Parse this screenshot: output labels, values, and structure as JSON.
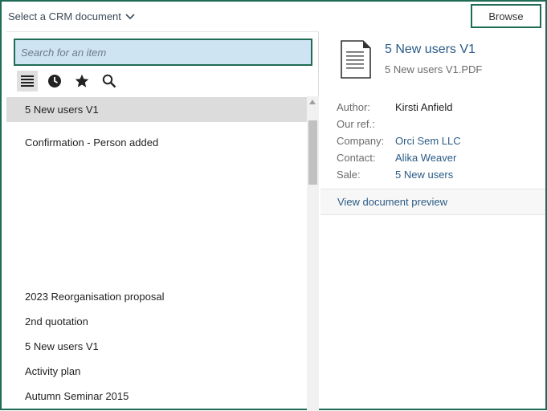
{
  "header": {
    "select_label": "Select a CRM document",
    "browse_label": "Browse"
  },
  "search": {
    "placeholder": "Search for an item"
  },
  "toolbar": {
    "tools": [
      {
        "icon": "list-icon",
        "active": true
      },
      {
        "icon": "clock-icon",
        "active": false
      },
      {
        "icon": "star-icon",
        "active": false
      },
      {
        "icon": "search-icon",
        "active": false
      }
    ]
  },
  "list": {
    "items": [
      {
        "label": "5 New users V1",
        "selected": true
      },
      {
        "label": "Confirmation - Person added",
        "selected": false
      },
      {
        "label": "2023 Reorganisation proposal",
        "selected": false
      },
      {
        "label": "2nd quotation",
        "selected": false
      },
      {
        "label": "5 New users V1",
        "selected": false
      },
      {
        "label": "Activity plan",
        "selected": false
      },
      {
        "label": "Autumn Seminar 2015",
        "selected": false
      }
    ]
  },
  "details": {
    "title": "5 New users V1",
    "filename": "5 New users V1.PDF",
    "fields": [
      {
        "label": "Author:",
        "value": "Kirsti Anfield",
        "link": false
      },
      {
        "label": "Our ref.:",
        "value": "",
        "link": false
      },
      {
        "label": "Company:",
        "value": "Orci Sem LLC",
        "link": true
      },
      {
        "label": "Contact:",
        "value": "Alika Weaver",
        "link": true
      },
      {
        "label": "Sale:",
        "value": "5 New users",
        "link": true
      }
    ],
    "preview_label": "View document preview"
  },
  "colors": {
    "accent": "#1f6b55",
    "link": "#2a5b86",
    "search_bg": "#cfe4f3",
    "selected_bg": "#dcdcdc"
  }
}
